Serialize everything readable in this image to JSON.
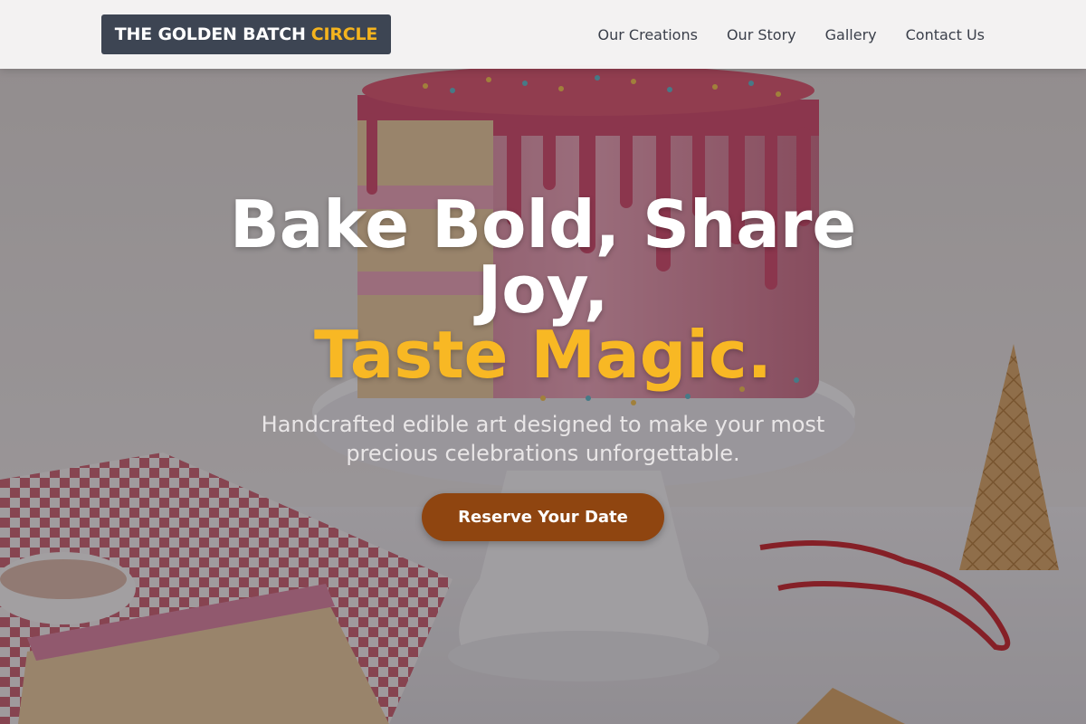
{
  "brand": {
    "name_main": "THE GOLDEN BATCH",
    "name_accent": "CIRCLE"
  },
  "nav": {
    "items": [
      {
        "label": "Our Creations"
      },
      {
        "label": "Our Story"
      },
      {
        "label": "Gallery"
      },
      {
        "label": "Contact Us"
      }
    ]
  },
  "hero": {
    "title_line1": "Bake Bold, Share Joy,",
    "title_line2": "Taste Magic.",
    "subtitle": "Handcrafted edible art designed to make your most precious celebrations unforgettable.",
    "cta_label": "Reserve Your Date"
  },
  "colors": {
    "logo_background": "#3d4553",
    "accent_gold": "#f5b41e",
    "cta_brown": "#8f4510",
    "header_background": "#f6f6f6"
  }
}
